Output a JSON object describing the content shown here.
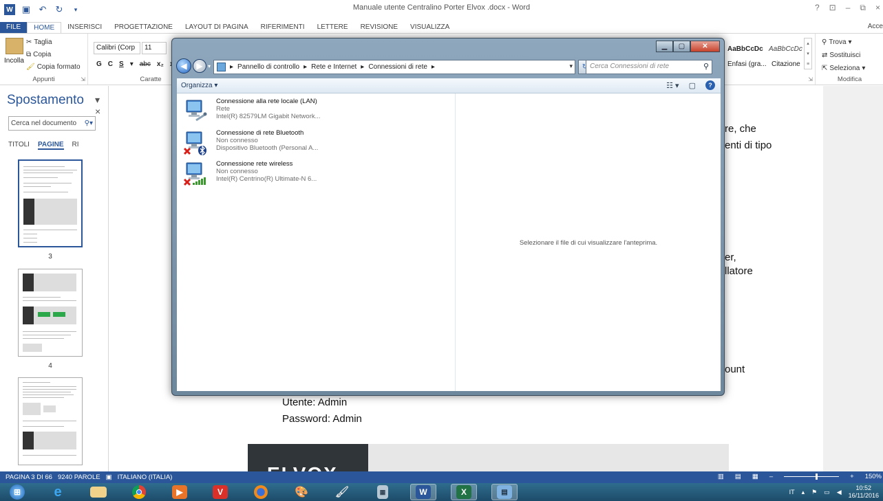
{
  "word": {
    "title": "Manuale utente Centralino Porter Elvox .docx - Word",
    "account": "Acce",
    "tabs": [
      "FILE",
      "HOME",
      "INSERISCI",
      "PROGETTAZIONE",
      "LAYOUT DI PAGINA",
      "RIFERIMENTI",
      "LETTERE",
      "REVISIONE",
      "VISUALIZZA"
    ],
    "ribbon": {
      "clipboard": {
        "paste": "Incolla",
        "cut": "Taglia",
        "copy": "Copia",
        "format_painter": "Copia formato",
        "label": "Appunti"
      },
      "font": {
        "font_name": "Calibri (Corp",
        "font_size": "11",
        "bold": "G",
        "italic": "C",
        "underline": "S",
        "strike": "abc",
        "subscript": "x₂",
        "superscript": "x²",
        "label": "Caratte"
      },
      "styles": {
        "style1_preview": "AaBbCcDc",
        "style1_name": "Enfasi (gra...",
        "style2_preview": "AaBbCcDc",
        "style2_name": "Citazione"
      },
      "editing": {
        "find": "Trova",
        "replace": "Sostituisci",
        "select": "Seleziona",
        "label": "Modifica"
      }
    },
    "nav": {
      "title": "Spostamento",
      "search_placeholder": "Cerca nel documento",
      "tabs": [
        "TITOLI",
        "PAGINE",
        "RI"
      ],
      "pages": [
        "3",
        "4"
      ]
    },
    "document": {
      "frag1": "re, che",
      "frag2": "enti di tipo",
      "frag3": "er,",
      "frag4": "llatore",
      "frag5": "ount",
      "user": "Utente: Admin",
      "password": "Password: Admin",
      "logo": "ELVOX"
    },
    "status": {
      "page": "PAGINA 3 DI 66",
      "words": "9240 PAROLE",
      "language": "ITALIANO (ITALIA)",
      "zoom": "150%"
    }
  },
  "explorer": {
    "breadcrumb": [
      "Pannello di controllo",
      "Rete e Internet",
      "Connessioni di rete"
    ],
    "search_placeholder": "Cerca Connessioni di rete",
    "organize": "Organizza",
    "preview_message": "Selezionare il file di cui visualizzare l'anteprima.",
    "connections": [
      {
        "name": "Connessione alla rete locale (LAN)",
        "status": "Rete",
        "device": "Intel(R) 82579LM Gigabit Network...",
        "icon": "lan-icon"
      },
      {
        "name": "Connessione di rete Bluetooth",
        "status": "Non connesso",
        "device": "Dispositivo Bluetooth (Personal A...",
        "icon": "bluetooth-icon"
      },
      {
        "name": "Connessione rete wireless",
        "status": "Non connesso",
        "device": "Intel(R) Centrino(R) Ultimate-N 6...",
        "icon": "wireless-icon"
      }
    ]
  },
  "taskbar": {
    "language": "IT",
    "time": "10:52",
    "date": "16/11/2016",
    "apps": [
      "start-orb",
      "internet-explorer",
      "file-explorer",
      "chrome",
      "media-center",
      "vivaldi",
      "firefox",
      "paint",
      "paint-brush",
      "calculator",
      "word",
      "excel",
      "control-panel"
    ]
  },
  "colors": {
    "word_blue": "#2b579a",
    "taskbar": "#2f6d8e",
    "close_red": "#c7432c"
  }
}
